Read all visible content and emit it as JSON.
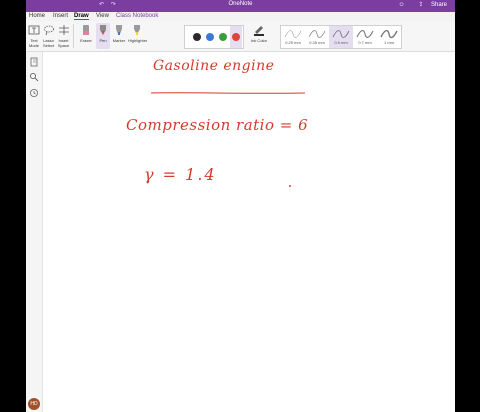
{
  "window": {
    "title": "OneNote",
    "undo_icon": "undo-icon",
    "redo_icon": "redo-icon",
    "share_label": "Share",
    "share_icon": "share-icon",
    "feedback_icon": "feedback-icon"
  },
  "menu": {
    "tabs": [
      "Home",
      "Insert",
      "Draw",
      "View",
      "Class Notebook"
    ],
    "active_tab": "Draw"
  },
  "ribbon": {
    "text_mode": "Text Mode",
    "lasso_select": "Lasso Select",
    "insert_space": "Insert Space",
    "eraser": "Eraser",
    "pen": "Pen",
    "marker": "Marker",
    "highlighter": "Highlighter",
    "ink_color": "Ink Color",
    "colors": [
      "#2b2b2b",
      "#3b7bd8",
      "#3a9f3a",
      "#e0443a"
    ],
    "selected_color": "#e0443a",
    "thicknesses": [
      "0.25 mm",
      "0.35 mm",
      "0.5 mm",
      "0.7 mm",
      "1 mm"
    ],
    "selected_thickness": "0.5 mm"
  },
  "sidebar": {
    "icons": [
      "notebooks-icon",
      "search-icon",
      "recent-icon"
    ],
    "avatar_initials": "HD"
  },
  "page": {
    "ink_color": "#d33b2c",
    "title": "Gasoline engine",
    "line1": "Compression ratio = 6",
    "line2": "γ = 1.4"
  }
}
